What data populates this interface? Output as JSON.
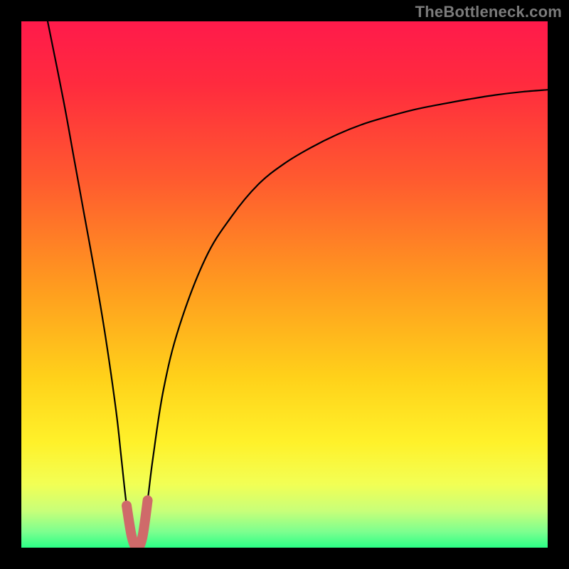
{
  "watermark": "TheBottleneck.com",
  "gradient_stops": [
    {
      "offset": 0,
      "color": "#ff1a4b"
    },
    {
      "offset": 0.12,
      "color": "#ff2b3e"
    },
    {
      "offset": 0.3,
      "color": "#ff5a2f"
    },
    {
      "offset": 0.5,
      "color": "#ff9a1f"
    },
    {
      "offset": 0.68,
      "color": "#ffd21a"
    },
    {
      "offset": 0.8,
      "color": "#fff12a"
    },
    {
      "offset": 0.88,
      "color": "#f2ff55"
    },
    {
      "offset": 0.93,
      "color": "#c8ff79"
    },
    {
      "offset": 0.97,
      "color": "#7cff8f"
    },
    {
      "offset": 1.0,
      "color": "#2bff86"
    }
  ],
  "curve_color": "#000000",
  "highlight_color": "#cf6a6a",
  "chart_data": {
    "type": "line",
    "title": "",
    "xlabel": "",
    "ylabel": "",
    "xlim": [
      0,
      100
    ],
    "ylim": [
      0,
      100
    ],
    "series": [
      {
        "name": "bottleneck-curve",
        "x": [
          5,
          8,
          10,
          12,
          14,
          16,
          18,
          19,
          20,
          21,
          22,
          23,
          24,
          25,
          27,
          30,
          35,
          40,
          45,
          50,
          55,
          60,
          65,
          70,
          75,
          80,
          85,
          90,
          95,
          100
        ],
        "y": [
          100,
          85,
          74,
          63,
          52,
          40,
          26,
          17,
          8,
          2,
          0,
          2,
          9,
          17,
          30,
          42,
          55,
          63,
          69,
          73,
          76,
          78.5,
          80.5,
          82,
          83.3,
          84.3,
          85.2,
          86,
          86.6,
          87
        ]
      }
    ],
    "minimum_point": {
      "x": 22,
      "y": 0
    },
    "highlight_segment": {
      "x": [
        20,
        21,
        22,
        23,
        24
      ],
      "y": [
        8,
        2,
        0,
        2,
        9
      ]
    }
  }
}
